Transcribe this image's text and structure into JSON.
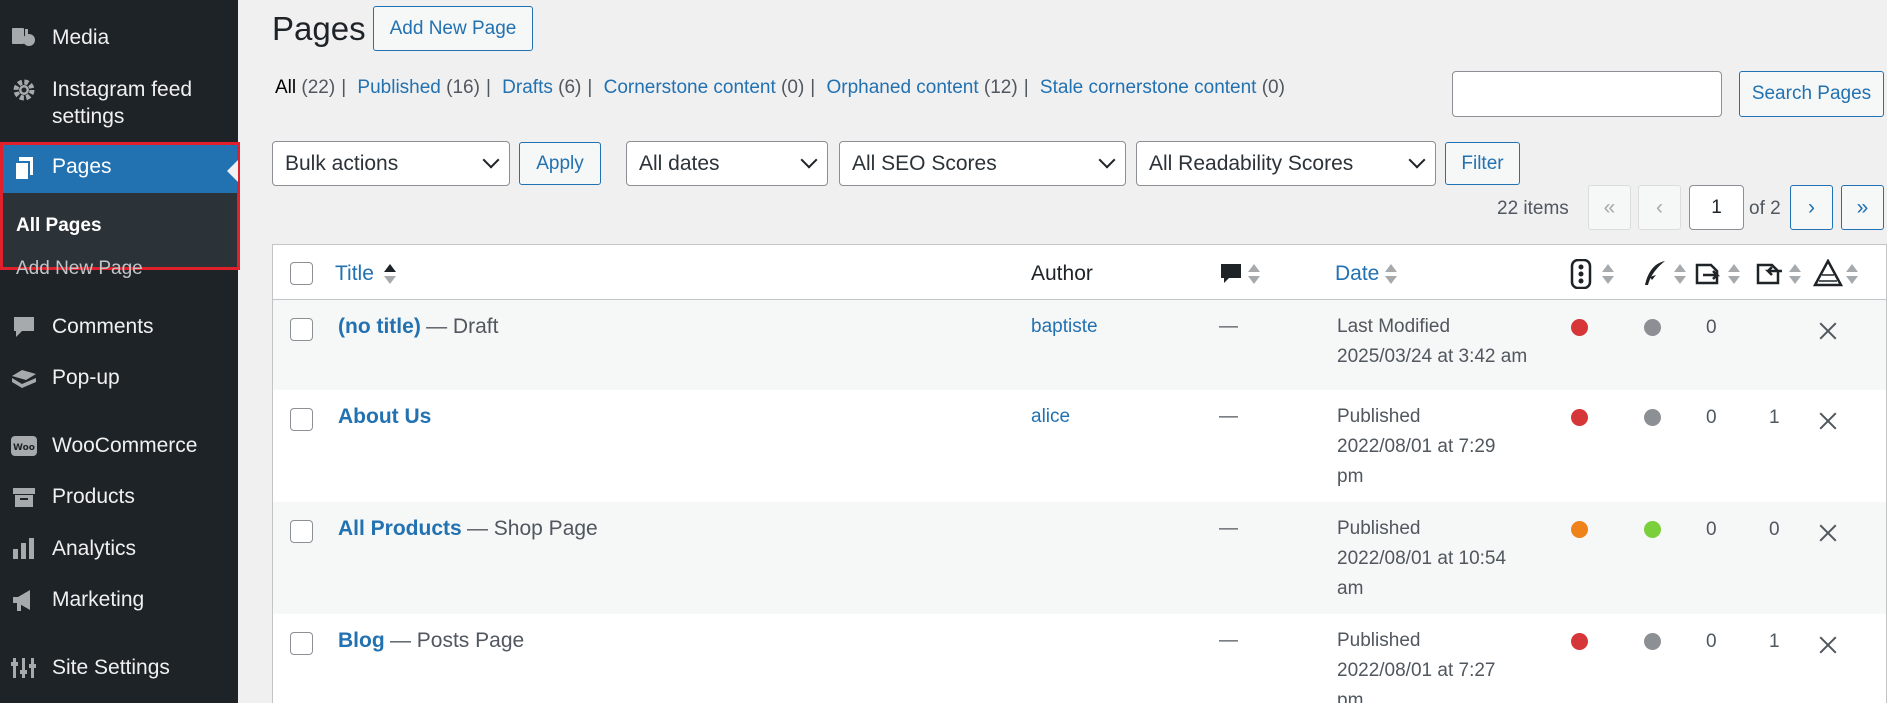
{
  "sidebar": {
    "media": "Media",
    "instagram": "Instagram feed settings",
    "pages": "Pages",
    "all_pages": "All Pages",
    "add_new_page": "Add New Page",
    "comments": "Comments",
    "popup": "Pop-up",
    "woocommerce": "WooCommerce",
    "woo_badge": "Woo",
    "products": "Products",
    "analytics": "Analytics",
    "marketing": "Marketing",
    "site_settings": "Site Settings"
  },
  "header": {
    "title": "Pages",
    "add_new": "Add New Page"
  },
  "views": {
    "all": "All",
    "all_count": "(22)",
    "published": "Published",
    "published_count": "(16)",
    "drafts": "Drafts",
    "drafts_count": "(6)",
    "cornerstone": "Cornerstone content",
    "cornerstone_count": "(0)",
    "orphaned": "Orphaned content",
    "orphaned_count": "(12)",
    "stale": "Stale cornerstone content",
    "stale_count": "(0)"
  },
  "search": {
    "value": "",
    "button": "Search Pages"
  },
  "filters": {
    "bulk_actions": "Bulk actions",
    "apply": "Apply",
    "dates": "All dates",
    "seo": "All SEO Scores",
    "readability": "All Readability Scores",
    "filter": "Filter"
  },
  "pagination": {
    "items": "22 items",
    "first": "«",
    "prev": "‹",
    "current": "1",
    "of": "of 2",
    "next": "›",
    "last": "»"
  },
  "table": {
    "headers": {
      "title": "Title",
      "author": "Author",
      "date": "Date"
    },
    "rows": [
      {
        "title": "(no title)",
        "state": "— Draft",
        "author": "baptiste",
        "comments": "—",
        "date_line1": "Last Modified",
        "date_line2": "2025/03/24 at 3:42 am",
        "date_line3": "",
        "seo_color": "#d63638",
        "read_color": "#8c8f94",
        "links_in": "0",
        "links_out": ""
      },
      {
        "title": "About Us",
        "state": "",
        "author": "alice",
        "comments": "—",
        "date_line1": "Published",
        "date_line2": "2022/08/01 at 7:29",
        "date_line3": "pm",
        "seo_color": "#d63638",
        "read_color": "#8c8f94",
        "links_in": "0",
        "links_out": "1"
      },
      {
        "title": "All Products",
        "state": "— Shop Page",
        "author": "",
        "comments": "—",
        "date_line1": "Published",
        "date_line2": "2022/08/01 at 10:54",
        "date_line3": "am",
        "seo_color": "#f0821a",
        "read_color": "#7ad03a",
        "links_in": "0",
        "links_out": "0"
      },
      {
        "title": "Blog",
        "state": "— Posts Page",
        "author": "",
        "comments": "—",
        "date_line1": "Published",
        "date_line2": "2022/08/01 at 7:27",
        "date_line3": "pm",
        "seo_color": "#d63638",
        "read_color": "#8c8f94",
        "links_in": "0",
        "links_out": "1"
      }
    ]
  },
  "icons": {
    "media": "media-icon",
    "settings": "gear-icon",
    "pages": "pages-icon",
    "comments": "comment-icon",
    "popup": "popup-icon",
    "woo": "woocommerce-icon",
    "products": "archive-icon",
    "analytics": "bar-chart-icon",
    "marketing": "megaphone-icon",
    "site_settings": "sliders-icon"
  }
}
